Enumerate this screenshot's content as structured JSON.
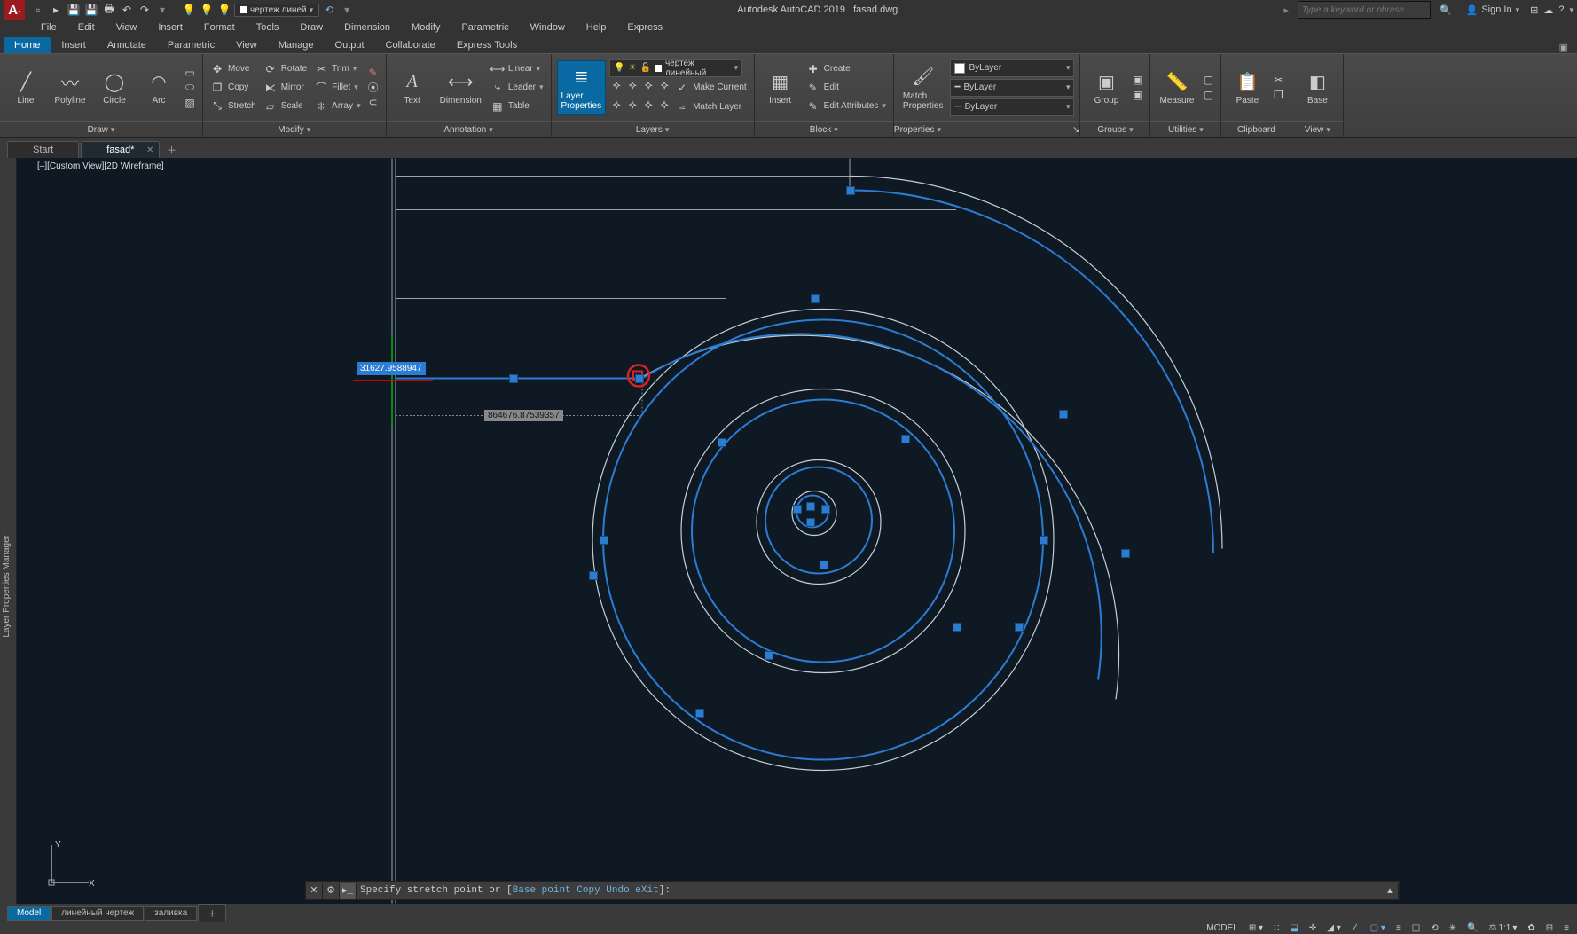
{
  "app": {
    "title": "Autodesk AutoCAD 2019",
    "filename": "fasad.dwg"
  },
  "search": {
    "placeholder": "Type a keyword or phrase"
  },
  "signin": {
    "label": "Sign In"
  },
  "qat_layer_pill": "чертеж линей",
  "menubar": [
    "File",
    "Edit",
    "View",
    "Insert",
    "Format",
    "Tools",
    "Draw",
    "Dimension",
    "Modify",
    "Parametric",
    "Window",
    "Help",
    "Express"
  ],
  "ribbon_tabs": [
    "Home",
    "Insert",
    "Annotate",
    "Parametric",
    "View",
    "Manage",
    "Output",
    "Collaborate",
    "Express Tools"
  ],
  "panels": {
    "draw": {
      "title": "Draw",
      "line": "Line",
      "polyline": "Polyline",
      "circle": "Circle",
      "arc": "Arc"
    },
    "modify": {
      "title": "Modify",
      "move": "Move",
      "rotate": "Rotate",
      "trim": "Trim",
      "copy": "Copy",
      "mirror": "Mirror",
      "fillet": "Fillet",
      "stretch": "Stretch",
      "scale": "Scale",
      "array": "Array"
    },
    "annotation": {
      "title": "Annotation",
      "text": "Text",
      "dimension": "Dimension",
      "linear": "Linear",
      "leader": "Leader",
      "table": "Table"
    },
    "layers": {
      "title": "Layers",
      "layer_properties": "Layer\nProperties",
      "current_layer": "чертеж линейный",
      "make_current": "Make Current",
      "match_layer": "Match Layer"
    },
    "block": {
      "title": "Block",
      "insert": "Insert",
      "create": "Create",
      "edit": "Edit",
      "edit_attributes": "Edit Attributes"
    },
    "properties": {
      "title": "Properties",
      "match": "Match\nProperties",
      "bylayer": "ByLayer"
    },
    "groups": {
      "title": "Groups",
      "group": "Group"
    },
    "utilities": {
      "title": "Utilities",
      "measure": "Measure"
    },
    "clipboard": {
      "title": "Clipboard",
      "paste": "Paste"
    },
    "view": {
      "title": "View",
      "base": "Base"
    }
  },
  "filetabs": {
    "start": "Start",
    "current": "fasad*"
  },
  "viewport": {
    "label": "[–][Custom View][2D Wireframe]"
  },
  "lpm": "Layer Properties Manager",
  "dynamic": {
    "input_value": "31627.9588947",
    "label_value": "864676.87539357"
  },
  "commandline": {
    "text": "Specify stretch point or ",
    "opts": [
      "Base point",
      "Copy",
      "Undo",
      "eXit"
    ],
    "end": ":"
  },
  "modeltabs": [
    "Model",
    "линейный чертеж",
    "заливка"
  ],
  "statusbar": {
    "space": "MODEL",
    "scale": "1:1"
  }
}
